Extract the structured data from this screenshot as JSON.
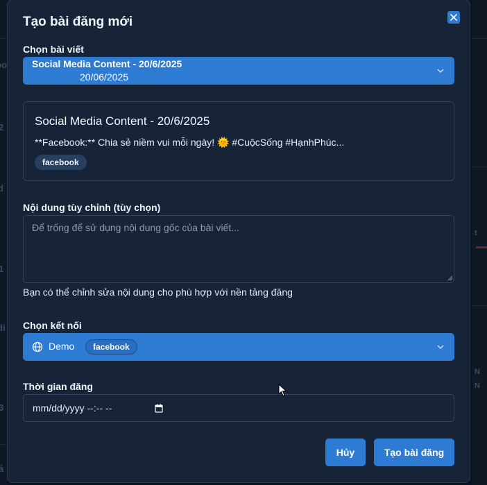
{
  "modal": {
    "title": "Tạo bài đăng mới",
    "close_icon": "close-icon"
  },
  "post_select": {
    "label": "Chọn bài viết",
    "selected_title": "Social Media Content - 20/6/2025",
    "selected_date": "20/06/2025",
    "icon": "chevron-down-icon"
  },
  "preview": {
    "title": "Social Media Content - 20/6/2025",
    "excerpt": "**Facebook:** Chia sẻ niềm vui mỗi ngày! 🌞 #CuộcSống #HạnhPhúc...",
    "platform": "facebook"
  },
  "custom_content": {
    "label": "Nội dung tùy chỉnh (tùy chọn)",
    "placeholder": "Để trống để sử dụng nội dung gốc của bài viết...",
    "value": "",
    "helper": "Bạn có thể chỉnh sửa nội dung cho phù hợp với nền tảng đăng"
  },
  "connection": {
    "label": "Chọn kết nối",
    "name": "Demo",
    "platform": "facebook",
    "icon": "globe-icon"
  },
  "schedule": {
    "label": "Thời gian đăng",
    "display_value": "mm/dd/yyyy --:-- --",
    "icon": "calendar-icon"
  },
  "actions": {
    "cancel_label": "Hủy",
    "create_label": "Tạo bài đăng"
  },
  "colors": {
    "modal_bg": "#172337",
    "accent": "#2e7bd3",
    "border": "#33445c",
    "badge_bg": "#28405f"
  },
  "background": {
    "left_fragments": [
      "po",
      "2",
      "d",
      "1",
      "di",
      "3",
      "ả"
    ],
    "right_fragments": [
      "t",
      "N",
      "N"
    ]
  }
}
